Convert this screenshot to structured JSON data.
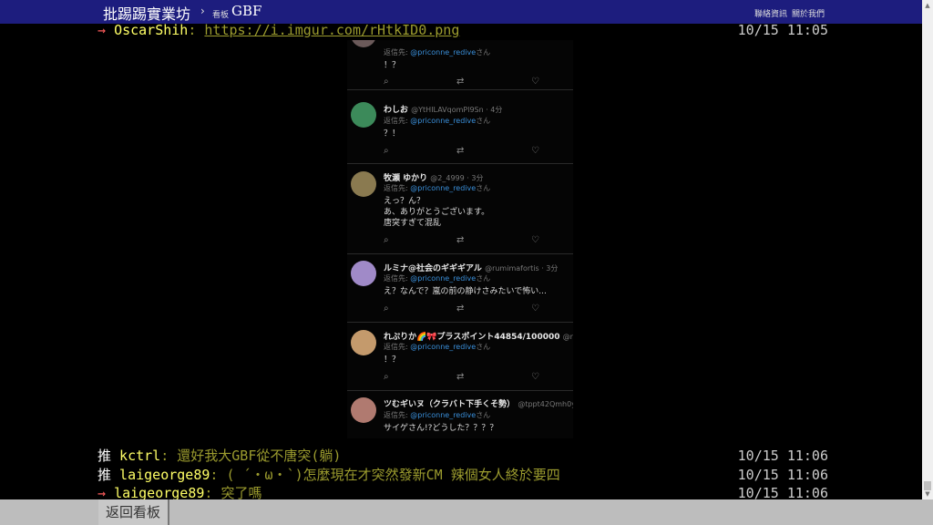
{
  "topbar": {
    "brand": "批踢踢實業坊",
    "separator": "›",
    "board_label": "看板",
    "board_name": "GBF",
    "contact": "聯絡資訊",
    "about": "關於我們"
  },
  "top_push": {
    "tag": "→",
    "userid": "OscarShih",
    "link": "https://i.imgur.com/rHtkID0.png",
    "time": "10/15 11:05"
  },
  "tweets": [
    {
      "name": "",
      "handle": "",
      "reply_prefix": "返信先:",
      "reply_to": "@priconne_redive",
      "reply_suffix": "さん",
      "text": "！？"
    },
    {
      "name": "わしお",
      "handle": "@YtHILAVqomPl9Sn · 4分",
      "reply_prefix": "返信先:",
      "reply_to": "@priconne_redive",
      "reply_suffix": "さん",
      "text": "？！"
    },
    {
      "name": "牧瀬 ゆかり",
      "handle": "@2_4999 · 3分",
      "reply_prefix": "返信先:",
      "reply_to": "@priconne_redive",
      "reply_suffix": "さん",
      "text": "えっ？ん？\nあ、ありがとうございます。\n唐突すぎて混乱"
    },
    {
      "name": "ルミナ@社会のギギギアル",
      "handle": "@rumimafortis · 3分",
      "reply_prefix": "返信先:",
      "reply_to": "@priconne_redive",
      "reply_suffix": "さん",
      "text": "え？なんで？嵐の前の静けさみたいで怖い..."
    },
    {
      "name": "れぷりか🌈🎀プラスポイント44854/100000",
      "handle": "@rep",
      "reply_prefix": "返信先:",
      "reply_to": "@priconne_redive",
      "reply_suffix": "さん",
      "text": "！？"
    },
    {
      "name": "ツむギいヌ（クラバト下手くそ勢）",
      "handle": "@tppt42Qmh0y",
      "reply_prefix": "返信先:",
      "reply_to": "@priconne_redive",
      "reply_suffix": "さん",
      "text": "サイゲさん!?どうした？？？？"
    }
  ],
  "pushes": [
    {
      "tag": "推",
      "userid": "kctrl",
      "content": ": 還好我大GBF從不唐突(躺)",
      "time": "10/15 11:06"
    },
    {
      "tag": "推",
      "userid": "laigeorge89",
      "content": ": ( ´・ω・`)怎麼現在才突然發新CM 辣個女人終於要四",
      "time": "10/15 11:06"
    },
    {
      "tag": "→",
      "userid": "laigeorge89",
      "content": ": 突了嗎",
      "time": "10/15 11:06"
    }
  ],
  "bottombar": {
    "back": "返回看板"
  },
  "colors": {
    "topbar": "#1d1d7e",
    "push_tag_arrow": "#ff5c5c",
    "userid": "#ffff66",
    "content": "#9b9b2e",
    "mention": "#3a8fd9"
  }
}
